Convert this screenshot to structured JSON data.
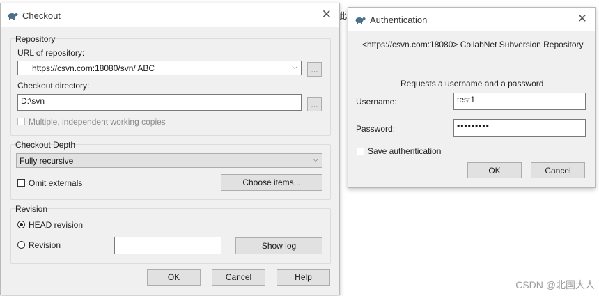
{
  "background_text": "此",
  "checkout": {
    "title": "Checkout",
    "close_glyph": "✕",
    "repository": {
      "group_label": "Repository",
      "url_label": "URL of repository:",
      "url_value": "https://csvn.com:18080/svn/ ABC",
      "browse_label": "...",
      "dir_label": "Checkout directory:",
      "dir_value": "D:\\svn",
      "dir_browse_label": "...",
      "multiple_label": "Multiple, independent working copies"
    },
    "depth": {
      "group_label": "Checkout Depth",
      "selected": "Fully recursive",
      "omit_label": "Omit externals",
      "choose_label": "Choose items..."
    },
    "revision": {
      "group_label": "Revision",
      "head_label": "HEAD revision",
      "revision_label": "Revision",
      "revision_value": "",
      "show_log_label": "Show log"
    },
    "buttons": {
      "ok": "OK",
      "cancel": "Cancel",
      "help": "Help"
    }
  },
  "auth": {
    "title": "Authentication",
    "close_glyph": "✕",
    "realm": "<https://csvn.com:18080> CollabNet Subversion Repository",
    "prompt": "Requests a username and a password",
    "username_label": "Username:",
    "username_value": "test1",
    "password_label": "Password:",
    "password_value": "•••••••••",
    "save_label": "Save authentication",
    "buttons": {
      "ok": "OK",
      "cancel": "Cancel"
    }
  },
  "watermark": "CSDN @北国大人",
  "icons": {
    "app": "tortoise-icon",
    "close": "close-icon",
    "dropdown": "chevron-down-icon"
  }
}
